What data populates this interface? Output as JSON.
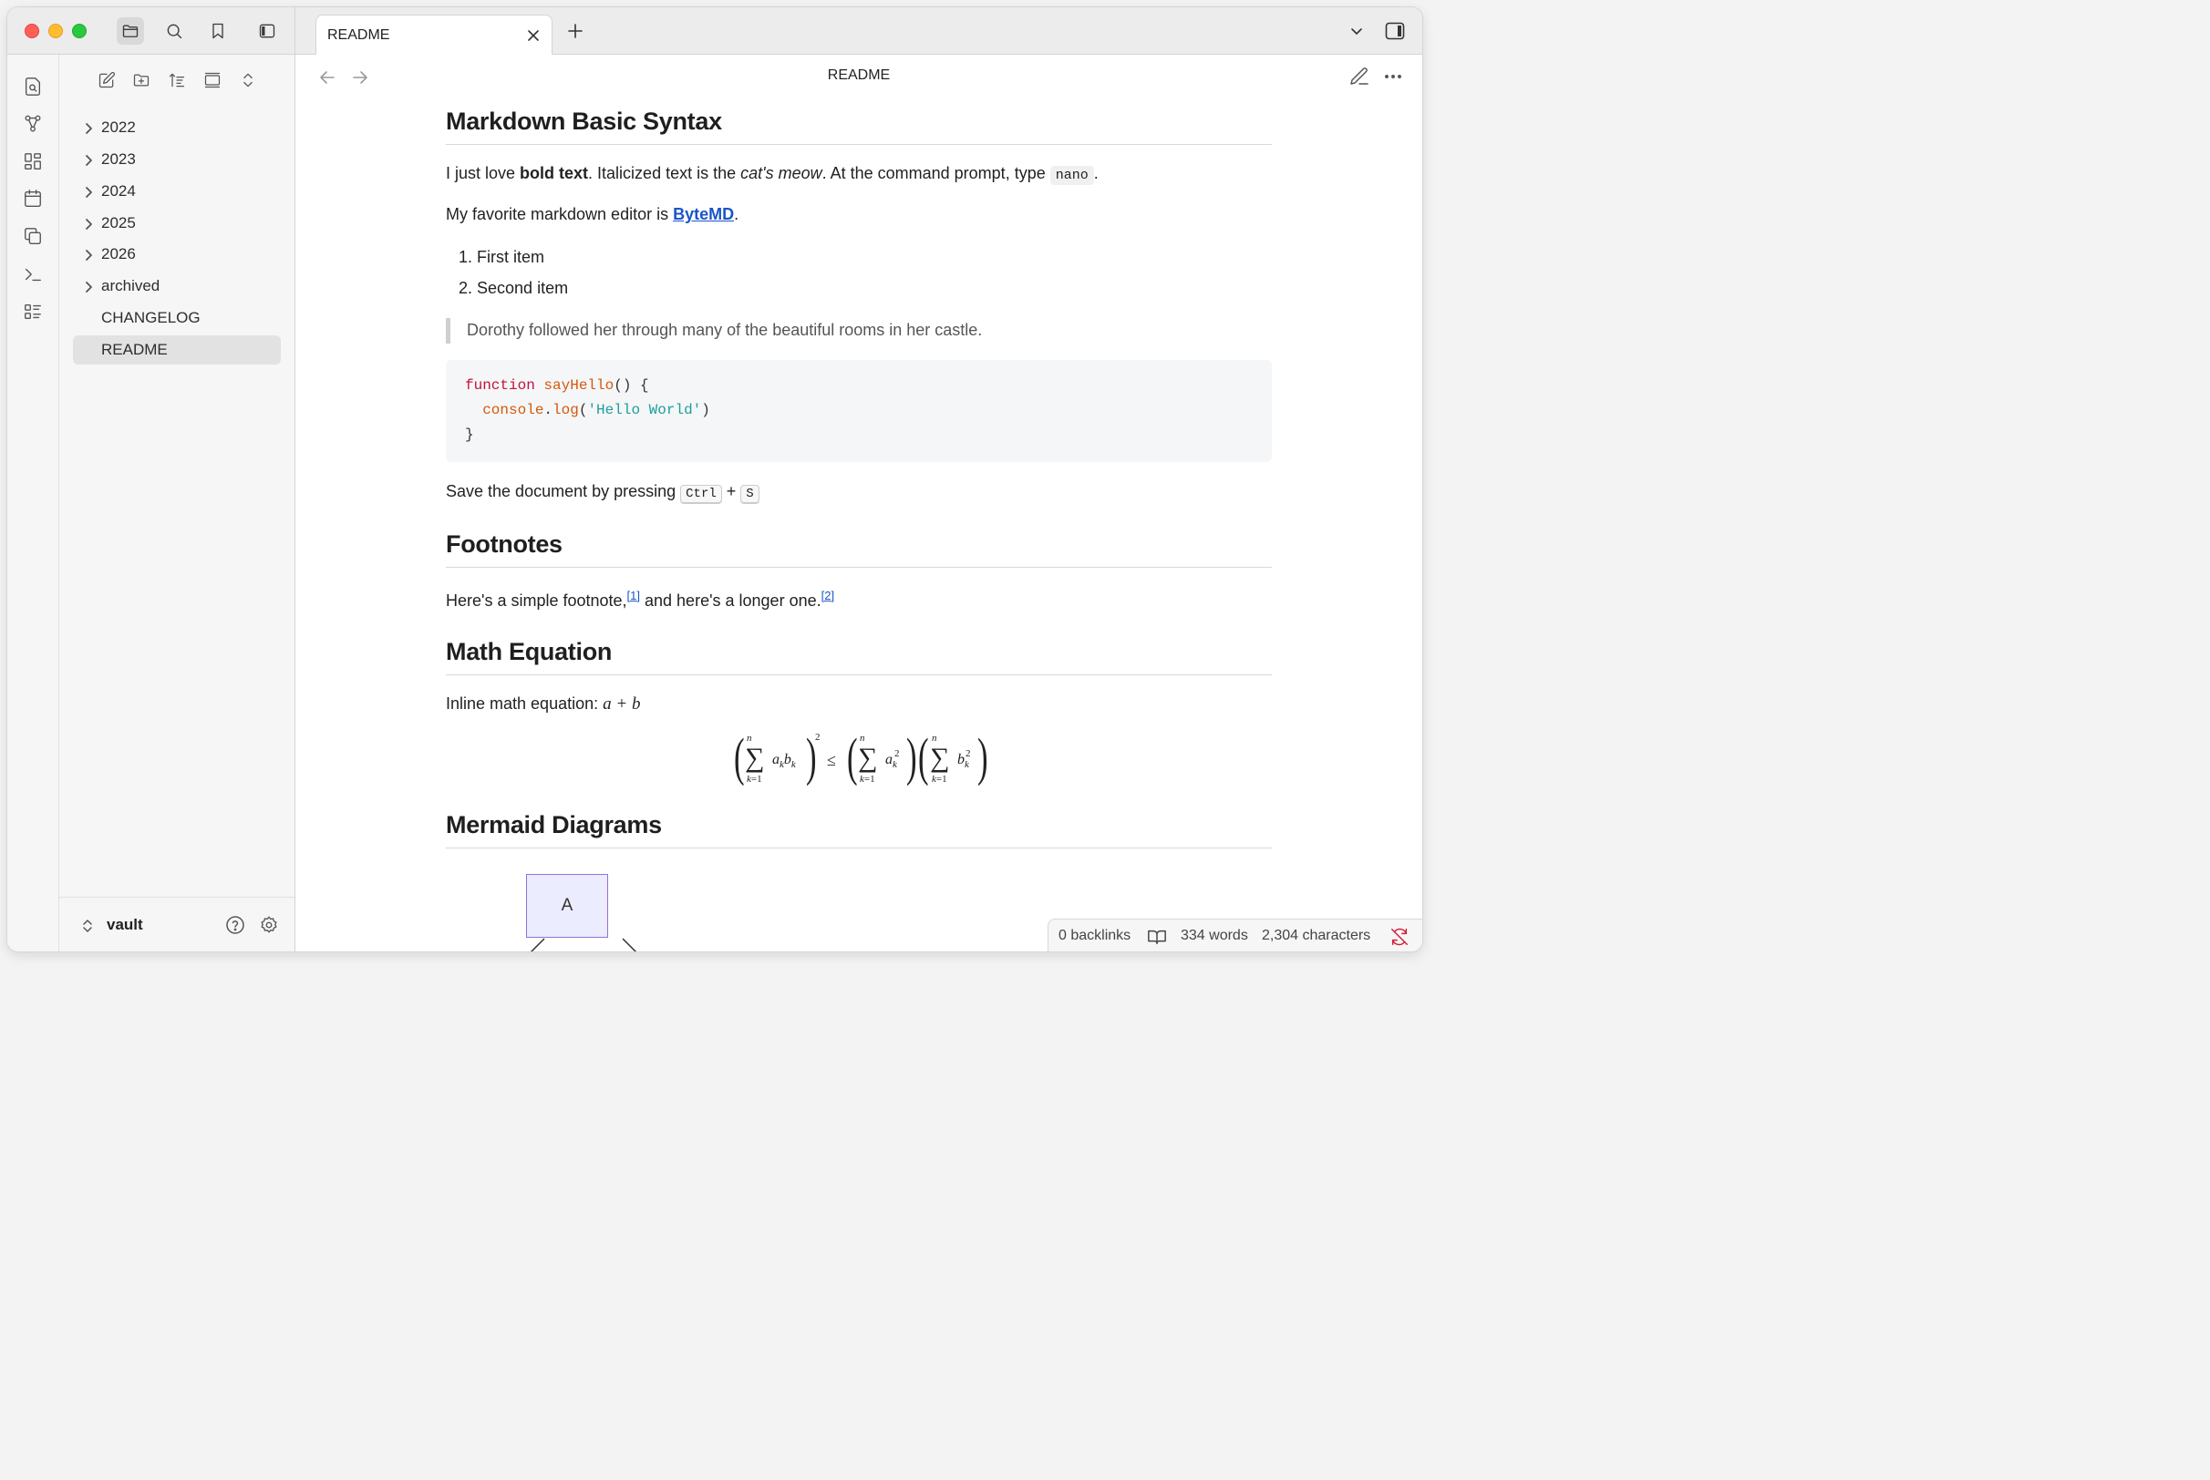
{
  "window": {
    "title_tab": "README",
    "view_title": "README"
  },
  "titlebar": {
    "icons": [
      "folder-icon",
      "search-icon",
      "bookmark-icon",
      "sidebar-toggle-icon"
    ]
  },
  "ribbon": {
    "icons": [
      "file-search-icon",
      "graph-icon",
      "canvas-icon",
      "calendar-icon",
      "copy-icon",
      "terminal-icon",
      "list-icon"
    ]
  },
  "explorer": {
    "items": [
      {
        "label": "2022",
        "folder": true
      },
      {
        "label": "2023",
        "folder": true
      },
      {
        "label": "2024",
        "folder": true
      },
      {
        "label": "2025",
        "folder": true
      },
      {
        "label": "2026",
        "folder": true
      },
      {
        "label": "archived",
        "folder": true
      },
      {
        "label": "CHANGELOG",
        "folder": false
      },
      {
        "label": "README",
        "folder": false,
        "selected": true
      }
    ],
    "vault_name": "vault"
  },
  "doc": {
    "h_basic": "Markdown Basic Syntax",
    "p1_a": "I just love ",
    "p1_bold": "bold text",
    "p1_b": ". Italicized text is the ",
    "p1_italic": "cat's meow",
    "p1_c": ". At the command prompt, type ",
    "p1_code": "nano",
    "p1_d": ".",
    "p2_a": "My favorite markdown editor is ",
    "p2_link": "ByteMD",
    "p2_b": ".",
    "list": [
      "First item",
      "Second item"
    ],
    "quote": "Dorothy followed her through many of the beautiful rooms in her castle.",
    "code": {
      "l1_kw": "function",
      "l1_fn": "sayHello",
      "l1_rest": "() {",
      "l2_obj": "console",
      "l2_dot": ".",
      "l2_fn": "log",
      "l2_open": "(",
      "l2_str": "'Hello World'",
      "l2_close": ")",
      "l3": "}"
    },
    "p3_a": "Save the document by pressing ",
    "p3_key1": "Ctrl",
    "p3_plus": " + ",
    "p3_key2": "S",
    "h_foot": "Footnotes",
    "p4_a": "Here's a simple footnote,",
    "p4_ref1": "[1]",
    "p4_b": " and here's a longer one.",
    "p4_ref2": "[2]",
    "h_math": "Math Equation",
    "p5_a": "Inline math equation: ",
    "p5_math": "a + b",
    "h_mermaid": "Mermaid Diagrams",
    "mermaid_node": "A"
  },
  "status": {
    "backlinks": "0 backlinks",
    "words": "334 words",
    "chars": "2,304 characters"
  },
  "colors": {
    "link": "#1a55c8",
    "keyword": "#c0143c",
    "function": "#d3590f",
    "string": "#1e9e9e",
    "sync_error": "#d11d3a"
  }
}
